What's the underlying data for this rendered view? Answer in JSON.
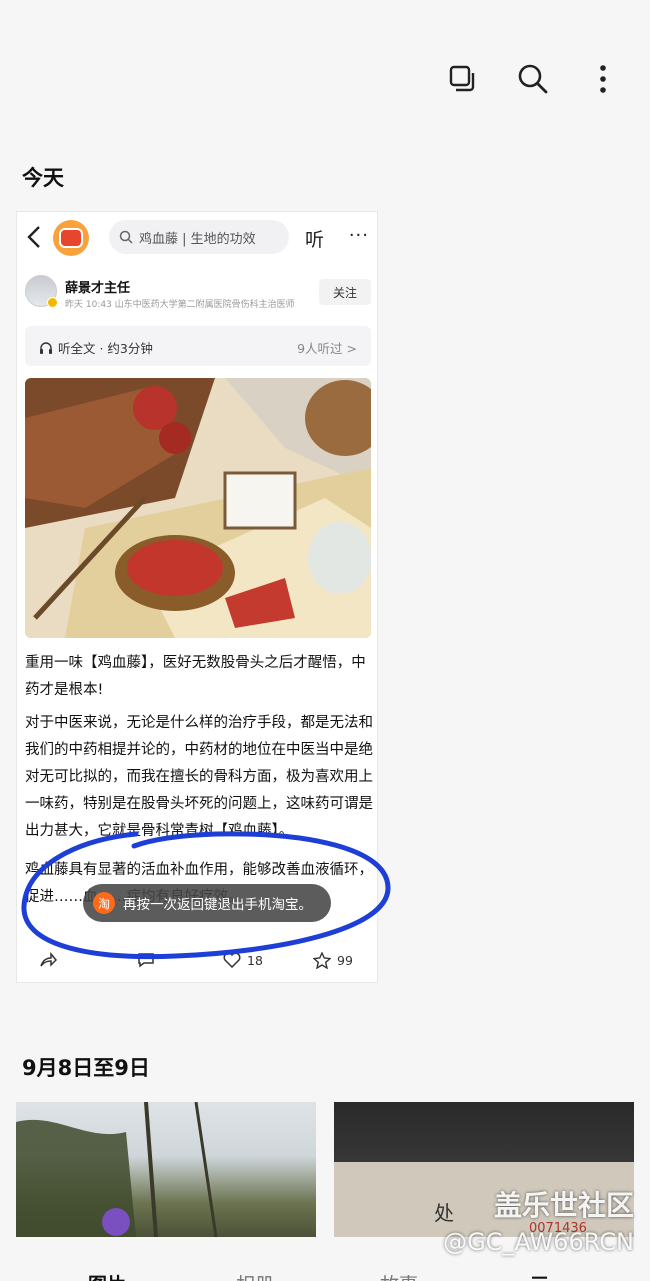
{
  "topbar": {
    "icons": [
      "select-copy-icon",
      "search-icon",
      "more-vertical-icon"
    ]
  },
  "sections": {
    "today": "今天",
    "date_range": "9月8日至9日"
  },
  "card": {
    "search_text": "鸡血藤 | 生地的功效",
    "listen_label": "听",
    "more_label": "···",
    "author": {
      "name": "薛景才主任",
      "meta": "昨天 10:43 山东中医药大学第二附属医院骨伤科主治医师",
      "follow_label": "关注"
    },
    "listenbar": {
      "left": "听全文 · 约3分钟",
      "right": "9人听过 >"
    },
    "paragraphs": {
      "p1": "重用一味【鸡血藤】，医好无数股骨头之后才醒悟，中药才是根本!",
      "p2": "对于中医来说，无论是什么样的治疗手段，都是无法和我们的中药相提并论的，中药材的地位在中医当中是绝对无可比拟的，而我在擅长的骨科方面，极为喜欢用上一味药，特别是在股骨头坏死的问题上，这味药可谓是出力甚大，它就是骨科常青树【鸡血藤】。",
      "p3": "鸡血藤具有显著的活血补血作用，能够改善血液循环，促进……血……症均有良好疗效。"
    },
    "toast": {
      "logo": "淘",
      "text": "再按一次返回键退出手机淘宝。"
    },
    "actions": {
      "like_count": "18",
      "star_count": "99"
    },
    "annotation_color": "#1d3fd6"
  },
  "watermark": {
    "line1": "盖乐世社区",
    "line2": "@GC_AW66RCN"
  },
  "bottom_tabs": [
    "图片",
    "相册",
    "故事",
    "三"
  ]
}
